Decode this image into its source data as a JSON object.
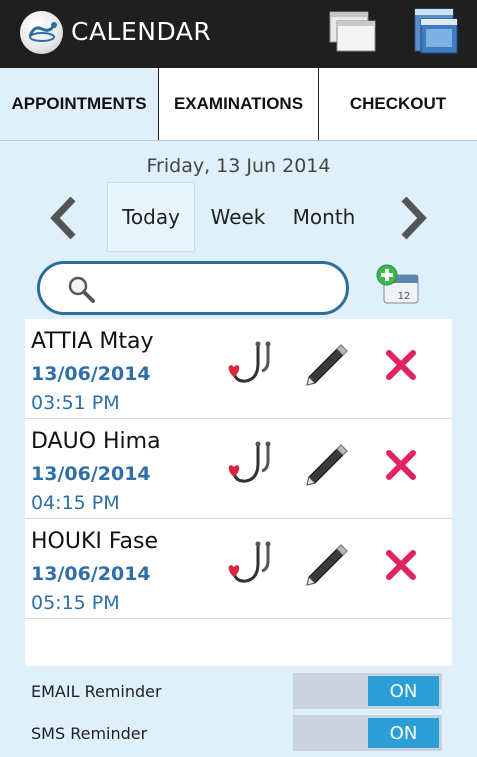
{
  "app": {
    "title": "CALENDAR"
  },
  "tabs": [
    {
      "label": "APPOINTMENTS",
      "active": true
    },
    {
      "label": "EXAMINATIONS",
      "active": false
    },
    {
      "label": "CHECKOUT",
      "active": false
    }
  ],
  "date_header": "Friday, 13 Jun 2014",
  "periods": [
    {
      "label": "Today",
      "selected": true
    },
    {
      "label": "Week",
      "selected": false
    },
    {
      "label": "Month",
      "selected": false
    }
  ],
  "search": {
    "value": "",
    "placeholder": ""
  },
  "appointments": [
    {
      "name": "ATTIA Mtay",
      "date": "13/06/2014",
      "time": "03:51 PM"
    },
    {
      "name": "DAUO Hima",
      "date": "13/06/2014",
      "time": "04:15 PM"
    },
    {
      "name": "HOUKI Fase",
      "date": "13/06/2014",
      "time": "05:15 PM"
    }
  ],
  "reminders": [
    {
      "label": "EMAIL Reminder",
      "state": "ON"
    },
    {
      "label": "SMS Reminder",
      "state": "ON"
    }
  ],
  "icons": {
    "logo": "stethoscope-logo",
    "windows": "windows-stack-icon",
    "window": "window-icon",
    "search": "search-icon",
    "add": "add-appointment-icon",
    "stethoscope": "stethoscope-icon",
    "edit": "pen-icon",
    "delete": "delete-icon"
  },
  "colors": {
    "actionbar": "#1f1f1f",
    "background": "#dff0fb",
    "accent": "#2f6fa8",
    "toggle_on": "#2b9ed5",
    "delete": "#e0245e"
  }
}
